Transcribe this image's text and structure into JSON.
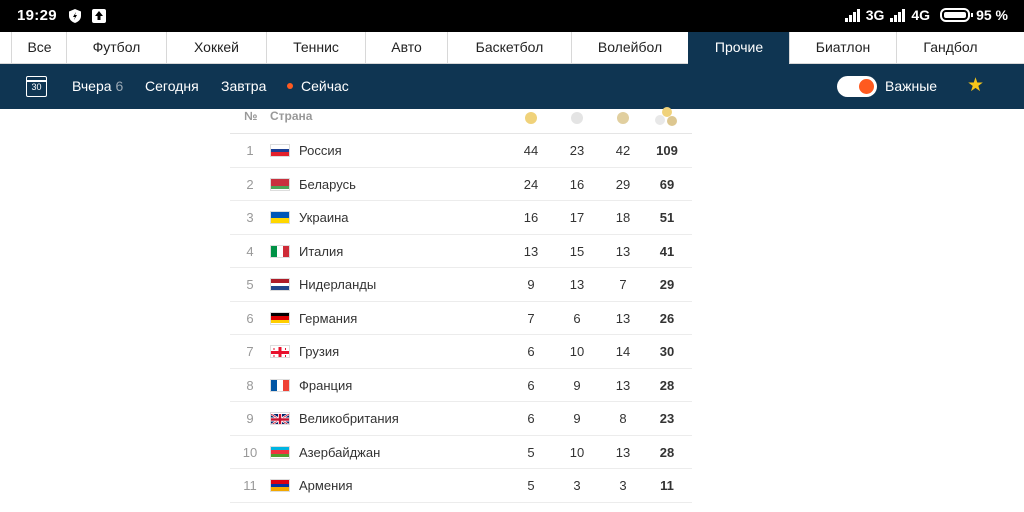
{
  "status": {
    "time": "19:29",
    "net1": "3G",
    "net2": "4G",
    "battery": "95 %"
  },
  "tabs": [
    {
      "label": "Все",
      "active": false
    },
    {
      "label": "Футбол",
      "active": false
    },
    {
      "label": "Хоккей",
      "active": false
    },
    {
      "label": "Теннис",
      "active": false
    },
    {
      "label": "Авто",
      "active": false
    },
    {
      "label": "Баскетбол",
      "active": false
    },
    {
      "label": "Волейбол",
      "active": false
    },
    {
      "label": "Прочие",
      "active": true
    },
    {
      "label": "Биатлон",
      "active": false
    },
    {
      "label": "Гандбол",
      "active": false
    }
  ],
  "nav": {
    "calendar_day": "30",
    "yesterday": "Вчера",
    "yesterday_count": "6",
    "today": "Сегодня",
    "tomorrow": "Завтра",
    "live": "Сейчас",
    "important": "Важные",
    "important_on": true
  },
  "table": {
    "col_num": "№",
    "col_country": "Страна",
    "rows": [
      {
        "num": "1",
        "country": "Россия",
        "flag": "russia",
        "gold": "44",
        "silver": "23",
        "bronze": "42",
        "total": "109"
      },
      {
        "num": "2",
        "country": "Беларусь",
        "flag": "belarus",
        "gold": "24",
        "silver": "16",
        "bronze": "29",
        "total": "69"
      },
      {
        "num": "3",
        "country": "Украина",
        "flag": "ukraine",
        "gold": "16",
        "silver": "17",
        "bronze": "18",
        "total": "51"
      },
      {
        "num": "4",
        "country": "Италия",
        "flag": "italy",
        "gold": "13",
        "silver": "15",
        "bronze": "13",
        "total": "41"
      },
      {
        "num": "5",
        "country": "Нидерланды",
        "flag": "netherlands",
        "gold": "9",
        "silver": "13",
        "bronze": "7",
        "total": "29"
      },
      {
        "num": "6",
        "country": "Германия",
        "flag": "germany",
        "gold": "7",
        "silver": "6",
        "bronze": "13",
        "total": "26"
      },
      {
        "num": "7",
        "country": "Грузия",
        "flag": "georgia",
        "gold": "6",
        "silver": "10",
        "bronze": "14",
        "total": "30"
      },
      {
        "num": "8",
        "country": "Франция",
        "flag": "france",
        "gold": "6",
        "silver": "9",
        "bronze": "13",
        "total": "28"
      },
      {
        "num": "9",
        "country": "Великобритания",
        "flag": "uk",
        "gold": "6",
        "silver": "9",
        "bronze": "8",
        "total": "23"
      },
      {
        "num": "10",
        "country": "Азербайджан",
        "flag": "azerbaijan",
        "gold": "5",
        "silver": "10",
        "bronze": "13",
        "total": "28"
      },
      {
        "num": "11",
        "country": "Армения",
        "flag": "armenia",
        "gold": "5",
        "silver": "3",
        "bronze": "3",
        "total": "11"
      }
    ]
  },
  "colors": {
    "navy": "#0f3552",
    "accent": "#ff5a1f",
    "star": "#f6c61a"
  }
}
